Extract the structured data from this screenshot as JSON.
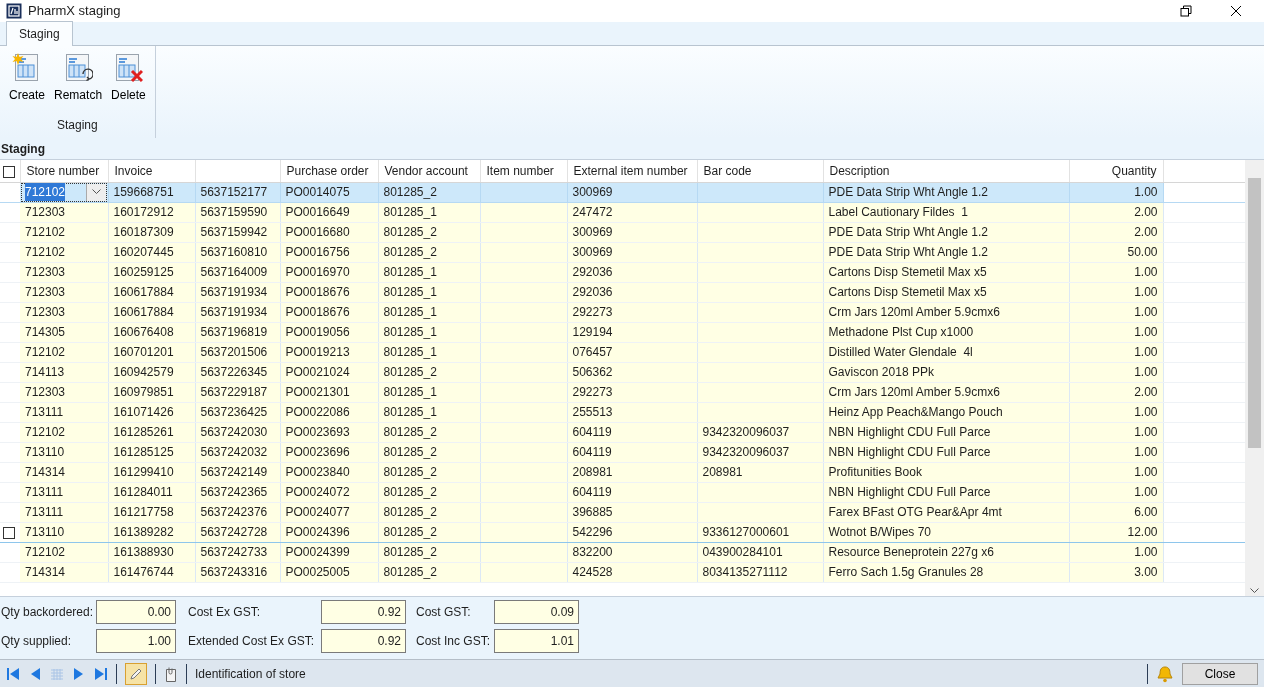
{
  "window": {
    "title": "PharmX staging"
  },
  "ribbon": {
    "tabs": [
      {
        "label": "Staging",
        "selected": true
      }
    ],
    "buttons": [
      {
        "label": "Create",
        "kind": "create"
      },
      {
        "label": "Rematch",
        "kind": "rematch"
      },
      {
        "label": "Delete",
        "kind": "delete"
      }
    ],
    "group_label": "Staging"
  },
  "section_title": "Staging",
  "table": {
    "select_all_checked": false,
    "columns": [
      {
        "label": "Store number"
      },
      {
        "label": "Invoice"
      },
      {},
      {
        "label": "Purchase order"
      },
      {
        "label": "Vendor account"
      },
      {
        "label": "Item number"
      },
      {
        "label": "External item number"
      },
      {
        "label": "Bar code"
      },
      {
        "label": "Description"
      },
      {
        "label": "Quantity"
      }
    ],
    "rows": [
      {
        "selected": true,
        "hovered": false,
        "store": "712102",
        "invoice": "159668751",
        "column_3": "5637152177",
        "po": "PO0014075",
        "vendor": "801285_2",
        "external": "300969",
        "description": "PDE Data Strip Wht Angle 1.2",
        "quantity": "1.00"
      },
      {
        "selected": false,
        "hovered": false,
        "store": "712303",
        "invoice": "160172912",
        "column_3": "5637159590",
        "po": "PO0016649",
        "vendor": "801285_1",
        "external": "247472",
        "description": "Label Cautionary Fildes  1",
        "quantity": "2.00"
      },
      {
        "selected": false,
        "hovered": false,
        "store": "712102",
        "invoice": "160187309",
        "column_3": "5637159942",
        "po": "PO0016680",
        "vendor": "801285_2",
        "external": "300969",
        "description": "PDE Data Strip Wht Angle 1.2",
        "quantity": "2.00"
      },
      {
        "selected": false,
        "hovered": false,
        "store": "712102",
        "invoice": "160207445",
        "column_3": "5637160810",
        "po": "PO0016756",
        "vendor": "801285_2",
        "external": "300969",
        "description": "PDE Data Strip Wht Angle 1.2",
        "quantity": "50.00"
      },
      {
        "selected": false,
        "hovered": false,
        "store": "712303",
        "invoice": "160259125",
        "column_3": "5637164009",
        "po": "PO0016970",
        "vendor": "801285_1",
        "external": "292036",
        "description": "Cartons Disp Stemetil Max x5",
        "quantity": "1.00"
      },
      {
        "selected": false,
        "hovered": false,
        "store": "712303",
        "invoice": "160617884",
        "column_3": "5637191934",
        "po": "PO0018676",
        "vendor": "801285_1",
        "external": "292036",
        "description": "Cartons Disp Stemetil Max x5",
        "quantity": "1.00"
      },
      {
        "selected": false,
        "hovered": false,
        "store": "712303",
        "invoice": "160617884",
        "column_3": "5637191934",
        "po": "PO0018676",
        "vendor": "801285_1",
        "external": "292273",
        "description": "Crm Jars 120ml Amber 5.9cmx6",
        "quantity": "1.00"
      },
      {
        "selected": false,
        "hovered": false,
        "store": "714305",
        "invoice": "160676408",
        "column_3": "5637196819",
        "po": "PO0019056",
        "vendor": "801285_1",
        "external": "129194",
        "description": "Methadone Plst Cup x1000",
        "quantity": "1.00"
      },
      {
        "selected": false,
        "hovered": false,
        "store": "712102",
        "invoice": "160701201",
        "column_3": "5637201506",
        "po": "PO0019213",
        "vendor": "801285_1",
        "external": "076457",
        "description": "Distilled Water Glendale  4l",
        "quantity": "1.00"
      },
      {
        "selected": false,
        "hovered": false,
        "store": "714113",
        "invoice": "160942579",
        "column_3": "5637226345",
        "po": "PO0021024",
        "vendor": "801285_2",
        "external": "506362",
        "description": "Gaviscon 2018 PPk",
        "quantity": "1.00"
      },
      {
        "selected": false,
        "hovered": false,
        "store": "712303",
        "invoice": "160979851",
        "column_3": "5637229187",
        "po": "PO0021301",
        "vendor": "801285_1",
        "external": "292273",
        "description": "Crm Jars 120ml Amber 5.9cmx6",
        "quantity": "2.00"
      },
      {
        "selected": false,
        "hovered": false,
        "store": "713111",
        "invoice": "161071426",
        "column_3": "5637236425",
        "po": "PO0022086",
        "vendor": "801285_1",
        "external": "255513",
        "description": "Heinz App Peach&Mango Pouch",
        "quantity": "1.00"
      },
      {
        "selected": false,
        "hovered": false,
        "store": "712102",
        "invoice": "161285261",
        "column_3": "5637242030",
        "po": "PO0023693",
        "vendor": "801285_2",
        "external": "604119",
        "barcode": "9342320096037",
        "description": "NBN Highlight CDU Full Parce",
        "quantity": "1.00"
      },
      {
        "selected": false,
        "hovered": false,
        "store": "713110",
        "invoice": "161285125",
        "column_3": "5637242032",
        "po": "PO0023696",
        "vendor": "801285_2",
        "external": "604119",
        "barcode": "9342320096037",
        "description": "NBN Highlight CDU Full Parce",
        "quantity": "1.00"
      },
      {
        "selected": false,
        "hovered": false,
        "store": "714314",
        "invoice": "161299410",
        "column_3": "5637242149",
        "po": "PO0023840",
        "vendor": "801285_2",
        "external": "208981",
        "barcode": "208981",
        "description": "Profitunities Book",
        "quantity": "1.00"
      },
      {
        "selected": false,
        "hovered": false,
        "store": "713111",
        "invoice": "161284011",
        "column_3": "5637242365",
        "po": "PO0024072",
        "vendor": "801285_2",
        "external": "604119",
        "description": "NBN Highlight CDU Full Parce",
        "quantity": "1.00"
      },
      {
        "selected": false,
        "hovered": false,
        "store": "713111",
        "invoice": "161217758",
        "column_3": "5637242376",
        "po": "PO0024077",
        "vendor": "801285_2",
        "external": "396885",
        "description": "Farex BFast OTG Pear&Apr 4mt",
        "quantity": "6.00"
      },
      {
        "selected": false,
        "hovered": true,
        "store": "713110",
        "invoice": "161389282",
        "column_3": "5637242728",
        "po": "PO0024396",
        "vendor": "801285_2",
        "external": "542296",
        "barcode": "9336127000601",
        "description": "Wotnot B/Wipes 70",
        "quantity": "12.00"
      },
      {
        "selected": false,
        "hovered": false,
        "store": "712102",
        "invoice": "161388930",
        "column_3": "5637242733",
        "po": "PO0024399",
        "vendor": "801285_2",
        "external": "832200",
        "barcode": "043900284101",
        "description": "Resource Beneprotein 227g x6",
        "quantity": "1.00"
      },
      {
        "selected": false,
        "hovered": false,
        "store": "714314",
        "invoice": "161476744",
        "column_3": "5637243316",
        "po": "PO0025005",
        "vendor": "801285_2",
        "external": "424528",
        "barcode": "8034135271112",
        "description": "Ferro Sach 1.5g Granules 28",
        "quantity": "3.00"
      }
    ]
  },
  "totals": [
    {
      "label": "Qty backordered:",
      "value": "0.00"
    },
    {
      "label": "Qty supplied:",
      "value": "1.00"
    },
    {
      "label": "Cost Ex GST:",
      "value": "0.92"
    },
    {
      "label": "Extended Cost Ex GST:",
      "value": "0.92"
    },
    {
      "label": "Cost GST:",
      "value": "0.09"
    },
    {
      "label": "Cost Inc GST:",
      "value": "1.01"
    }
  ],
  "status_bar": {
    "edit_mode": true,
    "help_text": "Identification of store",
    "close_label": "Close"
  }
}
